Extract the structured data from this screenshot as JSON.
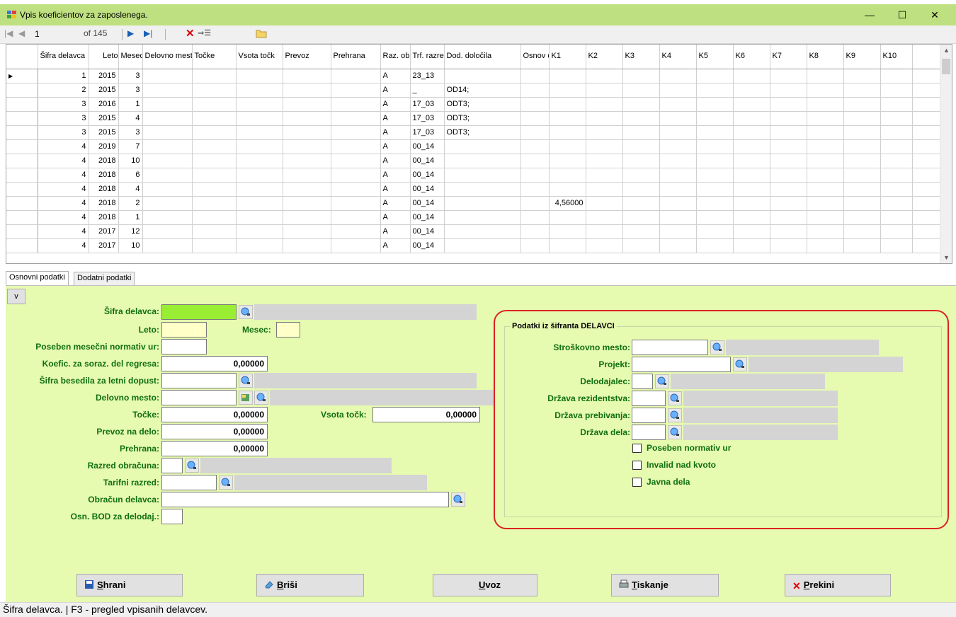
{
  "window": {
    "title": "Vpis koeficientov za zaposlenega.",
    "minimize": "—",
    "maximize": "☐",
    "close": "✕"
  },
  "navigator": {
    "position": "1",
    "of_label": "of 145",
    "first": "|◀",
    "prev": "◀",
    "next": "▶",
    "last": "▶|"
  },
  "grid": {
    "columns": [
      "Šifra delavca",
      "Leto",
      "Mesec",
      "Delovno mesto",
      "Točke",
      "Vsota točk",
      "Prevoz",
      "Prehrana",
      "Raz. obraču",
      "Trf. razred",
      "Dod. določila",
      "Osnov deloda",
      "K1",
      "K2",
      "K3",
      "K4",
      "K5",
      "K6",
      "K7",
      "K8",
      "K9",
      "K10"
    ],
    "rows": [
      [
        "1",
        "2015",
        "3",
        "",
        "",
        "",
        "",
        "",
        "A",
        "23_13",
        "",
        "",
        "",
        "",
        "",
        "",
        "",
        "",
        "",
        "",
        "",
        ""
      ],
      [
        "2",
        "2015",
        "3",
        "",
        "",
        "",
        "",
        "",
        "A",
        "_",
        "OD14;",
        "",
        "",
        "",
        "",
        "",
        "",
        "",
        "",
        "",
        "",
        ""
      ],
      [
        "3",
        "2016",
        "1",
        "",
        "",
        "",
        "",
        "",
        "A",
        "17_03",
        "ODT3;",
        "",
        "",
        "",
        "",
        "",
        "",
        "",
        "",
        "",
        "",
        ""
      ],
      [
        "3",
        "2015",
        "4",
        "",
        "",
        "",
        "",
        "",
        "A",
        "17_03",
        "ODT3;",
        "",
        "",
        "",
        "",
        "",
        "",
        "",
        "",
        "",
        "",
        ""
      ],
      [
        "3",
        "2015",
        "3",
        "",
        "",
        "",
        "",
        "",
        "A",
        "17_03",
        "ODT3;",
        "",
        "",
        "",
        "",
        "",
        "",
        "",
        "",
        "",
        "",
        ""
      ],
      [
        "4",
        "2019",
        "7",
        "",
        "",
        "",
        "",
        "",
        "A",
        "00_14",
        "",
        "",
        "",
        "",
        "",
        "",
        "",
        "",
        "",
        "",
        "",
        ""
      ],
      [
        "4",
        "2018",
        "10",
        "",
        "",
        "",
        "",
        "",
        "A",
        "00_14",
        "",
        "",
        "",
        "",
        "",
        "",
        "",
        "",
        "",
        "",
        "",
        ""
      ],
      [
        "4",
        "2018",
        "6",
        "",
        "",
        "",
        "",
        "",
        "A",
        "00_14",
        "",
        "",
        "",
        "",
        "",
        "",
        "",
        "",
        "",
        "",
        "",
        ""
      ],
      [
        "4",
        "2018",
        "4",
        "",
        "",
        "",
        "",
        "",
        "A",
        "00_14",
        "",
        "",
        "",
        "",
        "",
        "",
        "",
        "",
        "",
        "",
        "",
        ""
      ],
      [
        "4",
        "2018",
        "2",
        "",
        "",
        "",
        "",
        "",
        "A",
        "00_14",
        "",
        "",
        "4,56000",
        "",
        "",
        "",
        "",
        "",
        "",
        "",
        "",
        ""
      ],
      [
        "4",
        "2018",
        "1",
        "",
        "",
        "",
        "",
        "",
        "A",
        "00_14",
        "",
        "",
        "",
        "",
        "",
        "",
        "",
        "",
        "",
        "",
        "",
        ""
      ],
      [
        "4",
        "2017",
        "12",
        "",
        "",
        "",
        "",
        "",
        "A",
        "00_14",
        "",
        "",
        "",
        "",
        "",
        "",
        "",
        "",
        "",
        "",
        "",
        ""
      ],
      [
        "4",
        "2017",
        "10",
        "",
        "",
        "",
        "",
        "",
        "A",
        "00_14",
        "",
        "",
        "",
        "",
        "",
        "",
        "",
        "",
        "",
        "",
        "",
        ""
      ]
    ],
    "current_row_marker": "▶"
  },
  "tabs": [
    "Osnovni podatki",
    "Dodatni podatki"
  ],
  "form": {
    "toggle_label": "v",
    "sifra_delavca": "Šifra delavca:",
    "leto": "Leto:",
    "mesec": "Mesec:",
    "poseben_normativ": "Poseben mesečni normativ ur:",
    "koefic": "Koefic. za soraz. del regresa:",
    "koefic_value": "0,00000",
    "sifra_besedila": "Šifra besedila za letni dopust:",
    "delovno_mesto": "Delovno mesto:",
    "tocke": "Točke:",
    "tocke_value": "0,00000",
    "vsota_tock": "Vsota točk:",
    "vsota_tock_value": "0,00000",
    "prevoz": "Prevoz na delo:",
    "prevoz_value": "0,00000",
    "prehrana": "Prehrana:",
    "prehrana_value": "0,00000",
    "razred_obracuna": "Razred obračuna:",
    "tarifni_razred": "Tarifni razred:",
    "obracun_delavca": "Obračun delavca:",
    "osn_bod": "Osn. BOD za delodaj.:"
  },
  "group": {
    "title": "Podatki iz šifranta DELAVCI",
    "strosko": "Stroškovno mesto:",
    "projekt": "Projekt:",
    "delodajalec": "Delodajalec:",
    "drzava_rez": "Država rezidentstva:",
    "drzava_preb": "Država prebivanja:",
    "drzava_dela": "Država dela:",
    "chk_poseben": "Poseben normativ ur",
    "chk_invalid": "Invalid nad kvoto",
    "chk_javna": "Javna dela"
  },
  "buttons": {
    "shrani_u": "S",
    "shrani_rest": "hrani",
    "brisi_u": "B",
    "brisi_rest": "riši",
    "uvoz_u": "U",
    "uvoz_rest": "voz",
    "tiskanje_u": "T",
    "tiskanje_rest": "iskanje",
    "prekini_u": "P",
    "prekini_rest": "rekini"
  },
  "status": "Šifra delavca. | F3 - pregled vpisanih delavcev."
}
